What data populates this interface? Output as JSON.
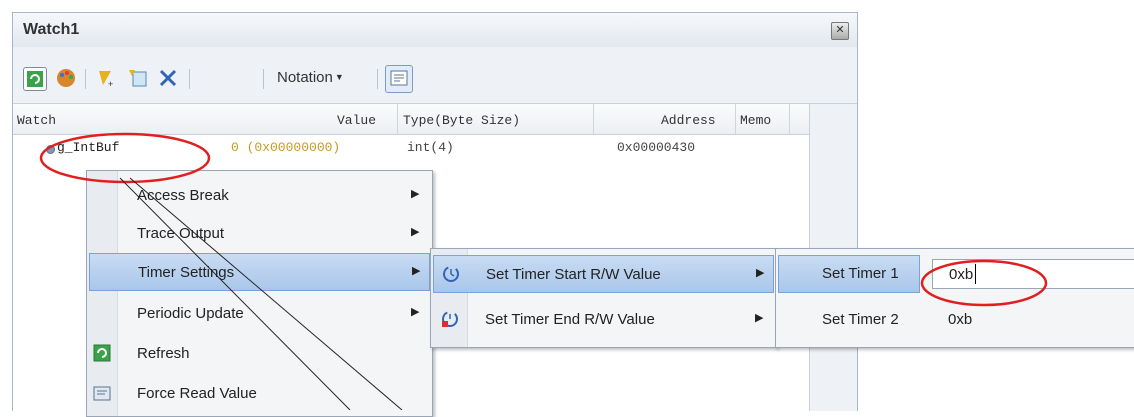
{
  "window": {
    "title": "Watch1"
  },
  "toolbar": {
    "icons": [
      "refresh-icon",
      "palette-icon",
      "add-watch-icon",
      "add-icon",
      "delete-x-icon",
      "notation-icon"
    ],
    "notation_label": "Notation"
  },
  "grid": {
    "headers": {
      "watch": "Watch",
      "value": "Value",
      "type": "Type(Byte Size)",
      "address": "Address",
      "memo": "Memo"
    },
    "rows": [
      {
        "watch": "g_IntBuf",
        "value": "0 (0x00000000)",
        "type": "int(4)",
        "address": "0x00000430",
        "memo": ""
      }
    ]
  },
  "context_menu": {
    "items": [
      {
        "label": "Access Break",
        "has_submenu": true
      },
      {
        "label": "Trace Output",
        "has_submenu": true
      },
      {
        "label": "Timer Settings",
        "has_submenu": true,
        "highlighted": true
      },
      {
        "label": "Periodic Update",
        "has_submenu": true
      },
      {
        "label": "Refresh",
        "icon": "refresh-icon"
      },
      {
        "label": "Force Read Value",
        "icon": "force-read-icon"
      }
    ]
  },
  "timer_submenu": {
    "items": [
      {
        "label": "Set Timer Start R/W Value",
        "icon": "timer-start-icon",
        "highlighted": true
      },
      {
        "label": "Set Timer End R/W Value",
        "icon": "timer-end-icon"
      }
    ]
  },
  "timer_select_submenu": {
    "items": [
      {
        "label": "Set Timer 1",
        "value": "0xb",
        "highlighted": true
      },
      {
        "label": "Set Timer 2",
        "value": "0xb"
      }
    ]
  },
  "colors": {
    "highlight": "#a9c6ea",
    "annotation": "#e02020",
    "window_bg": "#eef1f5"
  }
}
